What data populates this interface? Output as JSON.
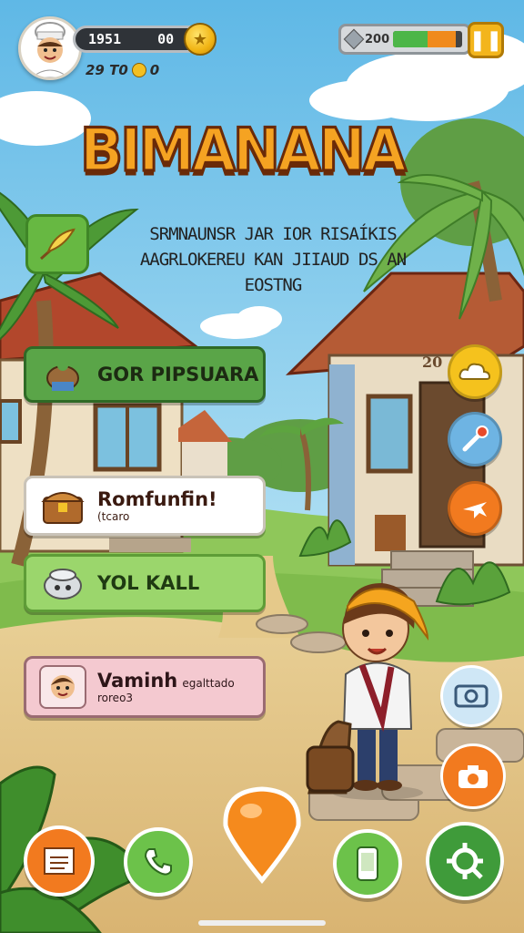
{
  "hud": {
    "resource_value": "1951",
    "resource_secondary": "00",
    "sub_stat": "29 T0",
    "sub_stat_coin_value": "0",
    "energy_label": "200",
    "energy_fraction": 0.9
  },
  "title": "BIMANANA",
  "subtitle": {
    "line1": "SRMNAUNSR JAR IOR RISAÍKIS",
    "line2": "AAGRLOKEREU KAN JIIAUD DS AN",
    "line3": "EOSTNG"
  },
  "house_sign": "20",
  "menu": {
    "item1": {
      "label": "GOR PIPSUARA"
    },
    "item2": {
      "label": "Romfunfin!",
      "sub": "(tcaro"
    },
    "item3": {
      "label": "YOL KALL"
    },
    "item4": {
      "label": "Vaminh",
      "tag": "egalttado",
      "sub": "roreo3"
    }
  },
  "icons": {
    "feather": "feather-quill-icon",
    "cloud": "cloud-icon",
    "wrench": "wrench-icon",
    "airplane": "airplane-icon",
    "camera_alt": "photo-icon",
    "camera": "camera-icon",
    "notes": "notes-icon",
    "phone": "phone-icon",
    "map_pin": "map-pin-icon",
    "tablet": "tablet-icon",
    "settings": "settings-icon"
  },
  "colors": {
    "title_fill": "#f5a322",
    "title_outline": "#6a2a08",
    "accent_green": "#5aa548",
    "accent_orange": "#f27a1f",
    "accent_gold": "#f3b51c"
  }
}
